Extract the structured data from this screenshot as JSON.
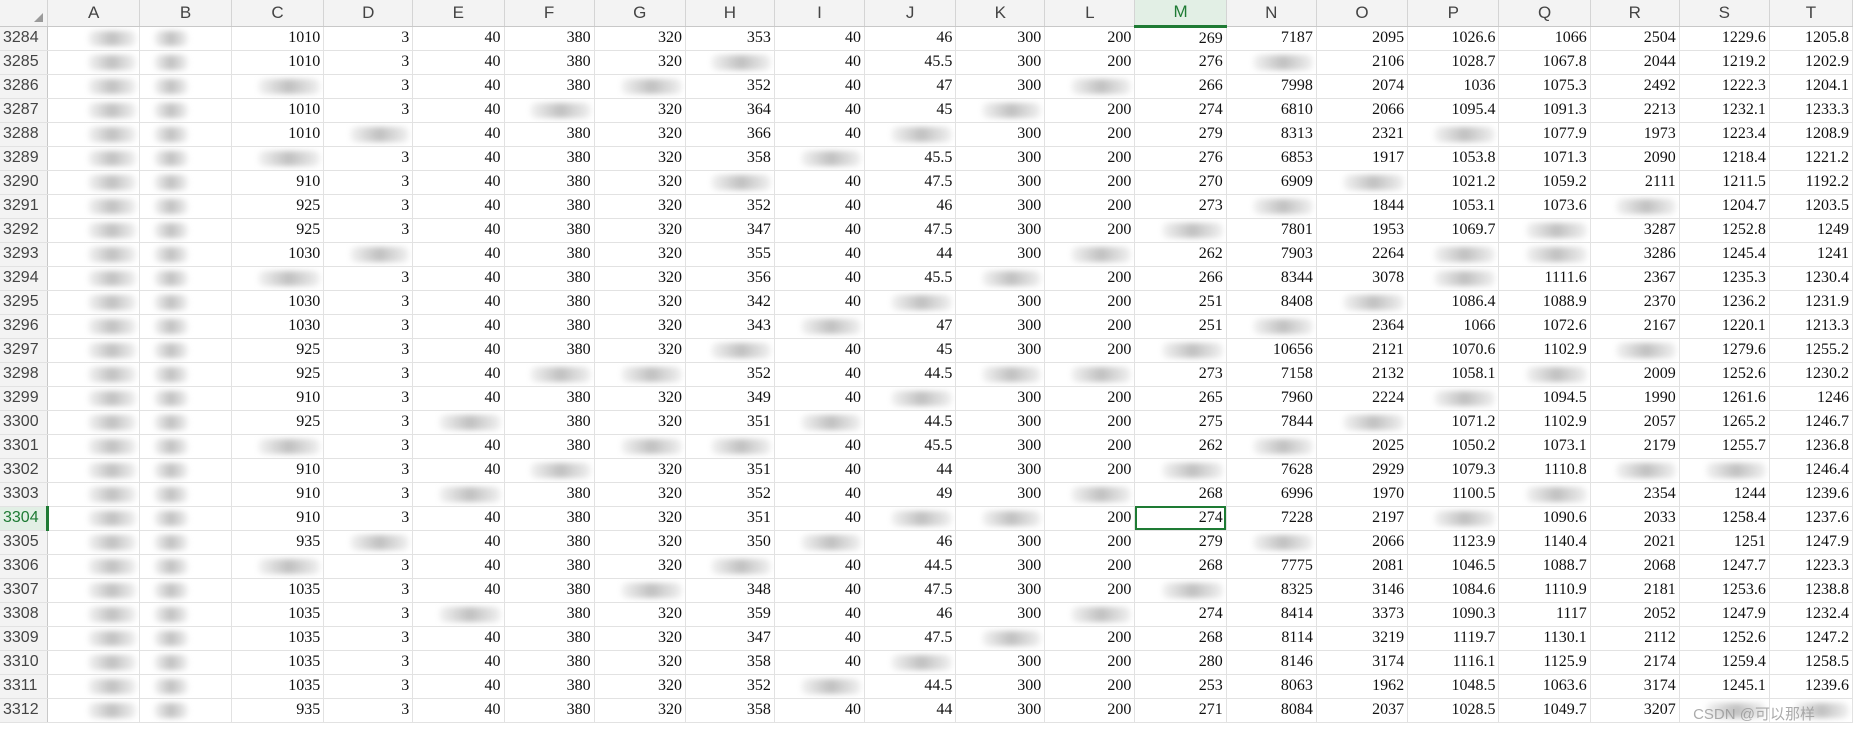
{
  "sheet": {
    "corner_icon": "select-all-triangle",
    "columns": [
      "A",
      "B",
      "C",
      "D",
      "E",
      "F",
      "G",
      "H",
      "I",
      "J",
      "K",
      "L",
      "M",
      "N",
      "O",
      "P",
      "Q",
      "R",
      "S",
      "T"
    ],
    "selected_column": "M",
    "selected_row": "3304",
    "accent_color": "#1e7b34",
    "rows": [
      {
        "n": "3284",
        "c": [
          "",
          "",
          "1010",
          "3",
          "40",
          "380",
          "320",
          "353",
          "40",
          "46",
          "300",
          "200",
          "269",
          "7187",
          "2095",
          "1026.6",
          "1066",
          "2504",
          "1229.6",
          "1205.8"
        ]
      },
      {
        "n": "3285",
        "c": [
          "",
          "",
          "1010",
          "3",
          "40",
          "380",
          "320",
          "",
          "40",
          "45.5",
          "300",
          "200",
          "276",
          "",
          "2106",
          "1028.7",
          "1067.8",
          "2044",
          "1219.2",
          "1202.9"
        ]
      },
      {
        "n": "3286",
        "c": [
          "",
          "",
          "",
          "3",
          "40",
          "380",
          "",
          "352",
          "40",
          "47",
          "300",
          "",
          "266",
          "7998",
          "2074",
          "1036",
          "1075.3",
          "2492",
          "1222.3",
          "1204.1"
        ]
      },
      {
        "n": "3287",
        "c": [
          "",
          "",
          "1010",
          "3",
          "40",
          "",
          "320",
          "364",
          "40",
          "45",
          "",
          "200",
          "274",
          "6810",
          "2066",
          "1095.4",
          "1091.3",
          "2213",
          "1232.1",
          "1233.3"
        ]
      },
      {
        "n": "3288",
        "c": [
          "",
          "",
          "1010",
          "",
          "40",
          "380",
          "320",
          "366",
          "40",
          "",
          "300",
          "200",
          "279",
          "8313",
          "2321",
          "",
          "1077.9",
          "1973",
          "1223.4",
          "1208.9"
        ]
      },
      {
        "n": "3289",
        "c": [
          "",
          "",
          "",
          "3",
          "40",
          "380",
          "320",
          "358",
          "",
          "45.5",
          "300",
          "200",
          "276",
          "6853",
          "1917",
          "1053.8",
          "1071.3",
          "2090",
          "1218.4",
          "1221.2"
        ]
      },
      {
        "n": "3290",
        "c": [
          "",
          "",
          "910",
          "3",
          "40",
          "380",
          "320",
          "",
          "40",
          "47.5",
          "300",
          "200",
          "270",
          "6909",
          "",
          "1021.2",
          "1059.2",
          "2111",
          "1211.5",
          "1192.2"
        ]
      },
      {
        "n": "3291",
        "c": [
          "",
          "",
          "925",
          "3",
          "40",
          "380",
          "320",
          "352",
          "40",
          "46",
          "300",
          "200",
          "273",
          "",
          "1844",
          "1053.1",
          "1073.6",
          "",
          "1204.7",
          "1203.5"
        ]
      },
      {
        "n": "3292",
        "c": [
          "",
          "",
          "925",
          "3",
          "40",
          "380",
          "320",
          "347",
          "40",
          "47.5",
          "300",
          "200",
          "",
          "7801",
          "1953",
          "1069.7",
          "",
          "3287",
          "1252.8",
          "1249"
        ]
      },
      {
        "n": "3293",
        "c": [
          "",
          "",
          "1030",
          "",
          "40",
          "380",
          "320",
          "355",
          "40",
          "44",
          "300",
          "",
          "262",
          "7903",
          "2264",
          "",
          "",
          "3286",
          "1245.4",
          "1241"
        ]
      },
      {
        "n": "3294",
        "c": [
          "",
          "",
          "",
          "3",
          "40",
          "380",
          "320",
          "356",
          "40",
          "45.5",
          "",
          "200",
          "266",
          "8344",
          "3078",
          "",
          "1111.6",
          "2367",
          "1235.3",
          "1230.4"
        ]
      },
      {
        "n": "3295",
        "c": [
          "",
          "",
          "1030",
          "3",
          "40",
          "380",
          "320",
          "342",
          "40",
          "",
          "300",
          "200",
          "251",
          "8408",
          "",
          "1086.4",
          "1088.9",
          "2370",
          "1236.2",
          "1231.9"
        ]
      },
      {
        "n": "3296",
        "c": [
          "",
          "",
          "1030",
          "3",
          "40",
          "380",
          "320",
          "343",
          "",
          "47",
          "300",
          "200",
          "251",
          "",
          "2364",
          "1066",
          "1072.6",
          "2167",
          "1220.1",
          "1213.3"
        ]
      },
      {
        "n": "3297",
        "c": [
          "",
          "",
          "925",
          "3",
          "40",
          "380",
          "320",
          "",
          "40",
          "45",
          "300",
          "200",
          "",
          "10656",
          "2121",
          "1070.6",
          "1102.9",
          "",
          "1279.6",
          "1255.2"
        ]
      },
      {
        "n": "3298",
        "c": [
          "",
          "",
          "925",
          "3",
          "40",
          "",
          "",
          "352",
          "40",
          "44.5",
          "",
          "",
          "273",
          "7158",
          "2132",
          "1058.1",
          "",
          "2009",
          "1252.6",
          "1230.2"
        ]
      },
      {
        "n": "3299",
        "c": [
          "",
          "",
          "910",
          "3",
          "40",
          "380",
          "320",
          "349",
          "40",
          "",
          "300",
          "200",
          "265",
          "7960",
          "2224",
          "",
          "1094.5",
          "1990",
          "1261.6",
          "1246"
        ]
      },
      {
        "n": "3300",
        "c": [
          "",
          "",
          "925",
          "3",
          "",
          "380",
          "320",
          "351",
          "",
          "44.5",
          "300",
          "200",
          "275",
          "7844",
          "",
          "1071.2",
          "1102.9",
          "2057",
          "1265.2",
          "1246.7"
        ]
      },
      {
        "n": "3301",
        "c": [
          "",
          "",
          "",
          "3",
          "40",
          "380",
          "",
          "",
          "40",
          "45.5",
          "300",
          "200",
          "262",
          "",
          "2025",
          "1050.2",
          "1073.1",
          "2179",
          "1255.7",
          "1236.8"
        ]
      },
      {
        "n": "3302",
        "c": [
          "",
          "",
          "910",
          "3",
          "40",
          "",
          "320",
          "351",
          "40",
          "44",
          "300",
          "200",
          "",
          "7628",
          "2929",
          "1079.3",
          "1110.8",
          "",
          "",
          "1246.4"
        ]
      },
      {
        "n": "3303",
        "c": [
          "",
          "",
          "910",
          "3",
          "",
          "380",
          "320",
          "352",
          "40",
          "49",
          "300",
          "",
          "268",
          "6996",
          "1970",
          "1100.5",
          "",
          "2354",
          "1244",
          "1239.6"
        ]
      },
      {
        "n": "3304",
        "c": [
          "",
          "",
          "910",
          "3",
          "40",
          "380",
          "320",
          "351",
          "40",
          "",
          "",
          "200",
          "274",
          "7228",
          "2197",
          "",
          "1090.6",
          "2033",
          "1258.4",
          "1237.6"
        ]
      },
      {
        "n": "3305",
        "c": [
          "",
          "",
          "935",
          "",
          "40",
          "380",
          "320",
          "350",
          "",
          "46",
          "300",
          "200",
          "279",
          "",
          "2066",
          "1123.9",
          "1140.4",
          "2021",
          "1251",
          "1247.9"
        ]
      },
      {
        "n": "3306",
        "c": [
          "",
          "",
          "",
          "3",
          "40",
          "380",
          "320",
          "",
          "40",
          "44.5",
          "300",
          "200",
          "268",
          "7775",
          "2081",
          "1046.5",
          "1088.7",
          "2068",
          "1247.7",
          "1223.3"
        ]
      },
      {
        "n": "3307",
        "c": [
          "",
          "",
          "1035",
          "3",
          "40",
          "380",
          "",
          "348",
          "40",
          "47.5",
          "300",
          "200",
          "",
          "8325",
          "3146",
          "1084.6",
          "1110.9",
          "2181",
          "1253.6",
          "1238.8"
        ]
      },
      {
        "n": "3308",
        "c": [
          "",
          "",
          "1035",
          "3",
          "",
          "380",
          "320",
          "359",
          "40",
          "46",
          "300",
          "",
          "274",
          "8414",
          "3373",
          "1090.3",
          "1117",
          "2052",
          "1247.9",
          "1232.4"
        ]
      },
      {
        "n": "3309",
        "c": [
          "",
          "",
          "1035",
          "3",
          "40",
          "380",
          "320",
          "347",
          "40",
          "47.5",
          "",
          "200",
          "268",
          "8114",
          "3219",
          "1119.7",
          "1130.1",
          "2112",
          "1252.6",
          "1247.2"
        ]
      },
      {
        "n": "3310",
        "c": [
          "",
          "",
          "1035",
          "3",
          "40",
          "380",
          "320",
          "358",
          "40",
          "",
          "300",
          "200",
          "280",
          "8146",
          "3174",
          "1116.1",
          "1125.9",
          "2174",
          "1259.4",
          "1258.5"
        ]
      },
      {
        "n": "3311",
        "c": [
          "",
          "",
          "1035",
          "3",
          "40",
          "380",
          "320",
          "352",
          "",
          "44.5",
          "300",
          "200",
          "253",
          "8063",
          "1962",
          "1048.5",
          "1063.6",
          "3174",
          "1245.1",
          "1239.6"
        ]
      },
      {
        "n": "3312",
        "c": [
          "",
          "",
          "935",
          "3",
          "40",
          "380",
          "320",
          "358",
          "40",
          "44",
          "300",
          "200",
          "271",
          "8084",
          "2037",
          "1028.5",
          "1049.7",
          "3207",
          "",
          ""
        ]
      }
    ]
  },
  "watermark": "CSDN @可以那样"
}
